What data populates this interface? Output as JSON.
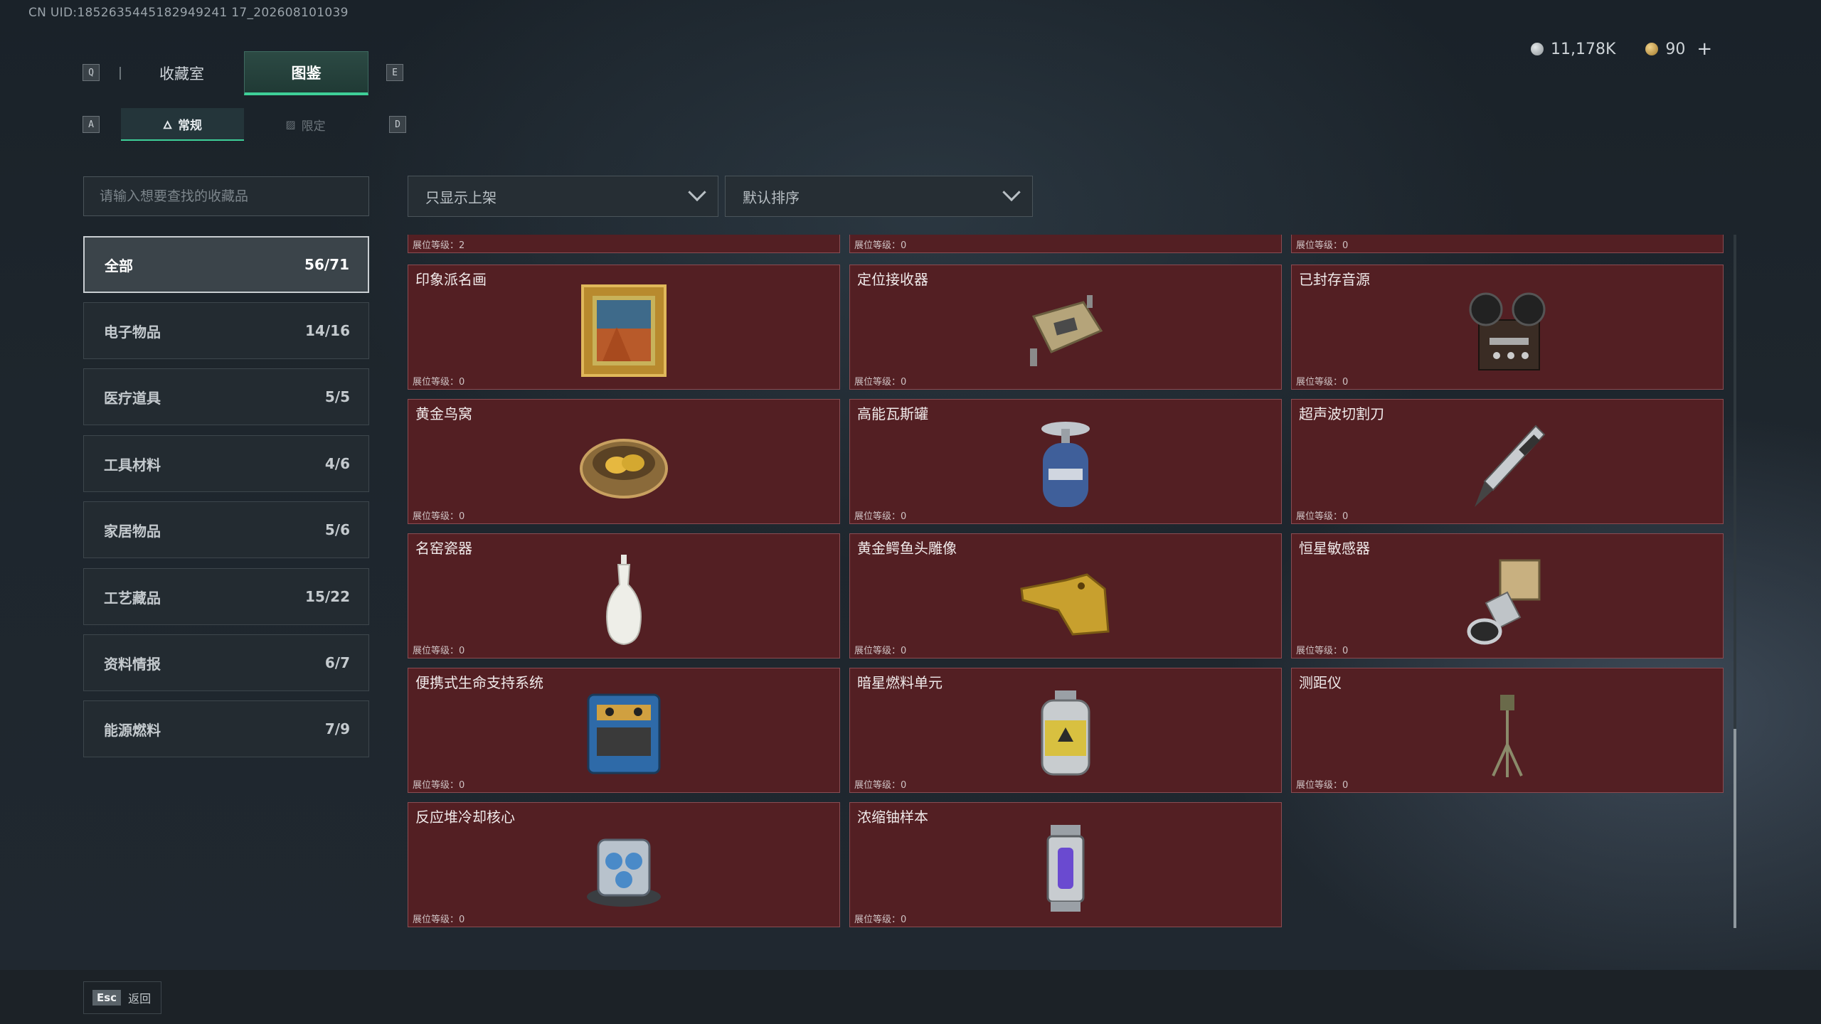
{
  "uid": "CN UID:1852635445182949241 17_202608101039",
  "currency": {
    "silver": "11,178K",
    "gold": "90",
    "plus": "+"
  },
  "tabs": {
    "left_key": "Q",
    "right_key": "E",
    "main": [
      {
        "label": "收藏室"
      },
      {
        "label": "图鉴"
      }
    ],
    "sub_left_key": "A",
    "sub_right_key": "D",
    "sub": [
      {
        "label": "常规"
      },
      {
        "label": "限定"
      }
    ]
  },
  "search": {
    "placeholder": "请输入想要查找的收藏品"
  },
  "filters": {
    "shelf": "只显示上架",
    "sort": "默认排序"
  },
  "categories": [
    {
      "label": "全部",
      "count": "56/71"
    },
    {
      "label": "电子物品",
      "count": "14/16"
    },
    {
      "label": "医疗道具",
      "count": "5/5"
    },
    {
      "label": "工具材料",
      "count": "4/6"
    },
    {
      "label": "家居物品",
      "count": "5/6"
    },
    {
      "label": "工艺藏品",
      "count": "15/22"
    },
    {
      "label": "资料情报",
      "count": "6/7"
    },
    {
      "label": "能源燃料",
      "count": "7/9"
    }
  ],
  "partial_row": [
    {
      "level": "展位等级：2"
    },
    {
      "level": "展位等级：0"
    },
    {
      "level": "展位等级：0"
    }
  ],
  "items": [
    {
      "name": "印象派名画",
      "level": "展位等级：0",
      "icon": "painting-icon"
    },
    {
      "name": "定位接收器",
      "level": "展位等级：0",
      "icon": "receiver-icon"
    },
    {
      "name": "已封存音源",
      "level": "展位等级：0",
      "icon": "tape-recorder-icon"
    },
    {
      "name": "黄金鸟窝",
      "level": "展位等级：0",
      "icon": "golden-nest-icon"
    },
    {
      "name": "高能瓦斯罐",
      "level": "展位等级：0",
      "icon": "gas-canister-icon"
    },
    {
      "name": "超声波切割刀",
      "level": "展位等级：0",
      "icon": "ultrasonic-cutter-icon"
    },
    {
      "name": "名窑瓷器",
      "level": "展位等级：0",
      "icon": "porcelain-vase-icon"
    },
    {
      "name": "黄金鳄鱼头雕像",
      "level": "展位等级：0",
      "icon": "golden-crocodile-icon"
    },
    {
      "name": "恒星敏感器",
      "level": "展位等级：0",
      "icon": "star-sensor-icon"
    },
    {
      "name": "便携式生命支持系统",
      "level": "展位等级：0",
      "icon": "life-support-icon"
    },
    {
      "name": "暗星燃料单元",
      "level": "展位等级：0",
      "icon": "fuel-cell-icon"
    },
    {
      "name": "测距仪",
      "level": "展位等级：0",
      "icon": "rangefinder-icon"
    },
    {
      "name": "反应堆冷却核心",
      "level": "展位等级：0",
      "icon": "reactor-core-icon"
    },
    {
      "name": "浓缩铀样本",
      "level": "展位等级：0",
      "icon": "uranium-sample-icon"
    }
  ],
  "footer": {
    "esc_key": "Esc",
    "back_label": "返回"
  }
}
